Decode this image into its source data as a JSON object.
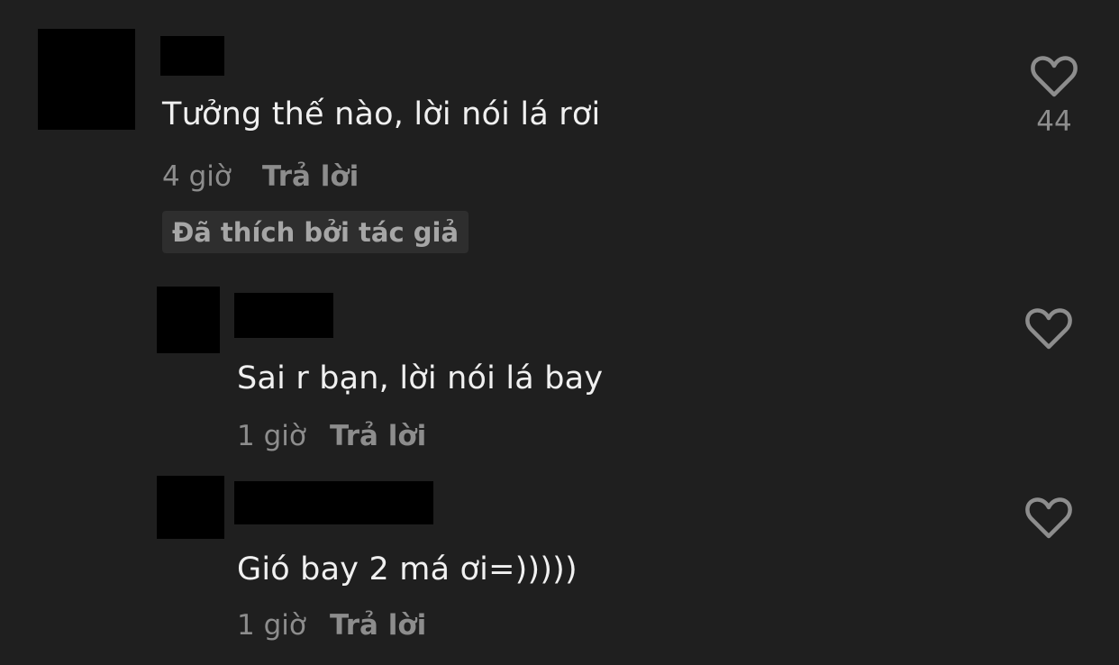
{
  "comments": [
    {
      "text": "Tưởng thế nào, lời nói lá rơi",
      "time": "4 giờ",
      "reply_label": "Trả lời",
      "badge": "Đã thích bởi tác giả",
      "like_count": "44",
      "like_icon": "heart-outline-icon"
    },
    {
      "text": "Sai r bạn, lời nói lá bay",
      "time": "1 giờ",
      "reply_label": "Trả lời",
      "like_icon": "heart-outline-icon"
    },
    {
      "text": "Gió bay 2 má ơi=)))))",
      "time": "1 giờ",
      "reply_label": "Trả lời",
      "like_icon": "heart-outline-icon"
    }
  ],
  "colors": {
    "background": "#1f1f1f",
    "redaction": "#000000",
    "text_primary": "#f0f0f0",
    "text_secondary": "#8d8d8d",
    "badge_background": "#2e2e2e"
  }
}
